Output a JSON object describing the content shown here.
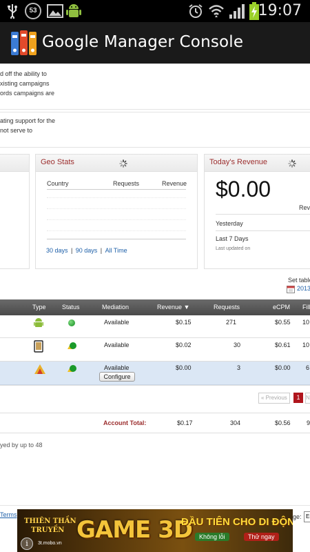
{
  "status_bar": {
    "notification_count": "53",
    "time": "19:07"
  },
  "app": {
    "title": "Google Manager Console"
  },
  "notices": [
    [
      "d off the ability to",
      "xisting campaigns",
      "ords campaigns are"
    ],
    [
      "ating support for the",
      " not serve to"
    ]
  ],
  "geo_stats": {
    "title": "Geo Stats",
    "columns": [
      "Country",
      "Requests",
      "Revenue"
    ],
    "links": [
      "30 days",
      "90 days",
      "All Time"
    ],
    "sep": "|"
  },
  "todays_revenue": {
    "title": "Today's Revenue",
    "amount": "$0.00",
    "rev_label": "Reve",
    "rows": [
      "Yesterday",
      "Last 7 Days"
    ],
    "updated": "Last updated on"
  },
  "table_settings": {
    "label": "Set table",
    "date": "2013"
  },
  "table": {
    "headers": [
      "Type",
      "Status",
      "Mediation",
      "Revenue",
      "Requests",
      "eCPM",
      "Fill"
    ],
    "sort_arrow": "▼",
    "rows": [
      {
        "mediation": "Available",
        "revenue": "$0.15",
        "requests": "271",
        "ecpm": "$0.55",
        "fill": "10",
        "type_icon": "android-icon",
        "status_color": "#1aa32a"
      },
      {
        "mediation": "Available",
        "revenue": "$0.02",
        "requests": "30",
        "ecpm": "$0.61",
        "fill": "10",
        "type_icon": "tablet-icon",
        "status_color": "#1aa32a"
      },
      {
        "mediation": "Available",
        "configure": "Configure",
        "revenue": "$0.00",
        "requests": "3",
        "ecpm": "$0.00",
        "fill": "6",
        "type_icon": "adwords-icon",
        "status_color": "#1aa32a"
      }
    ],
    "pagination": {
      "previous": "« Previous",
      "page": "1",
      "next": "N"
    },
    "total": {
      "label": "Account Total:",
      "revenue": "$0.17",
      "requests": "304",
      "ecpm": "$0.56",
      "fill": "9"
    }
  },
  "footer_note": "yed by up to 48",
  "bottom": {
    "terms": "Terms",
    "lang_label": "ge:",
    "lang_value": "En"
  },
  "ad_banner": {
    "brand_line1": "THIÊN THẦN",
    "brand_line2": "TRUYỀN",
    "brand_url": "3t.mobo.vn",
    "game_text": "GAME 3D",
    "headline": "ĐẦU TIÊN CHO DI ĐỘNG",
    "tag1": "Không lỗi",
    "tag2": "Thử ngay"
  },
  "colors": {
    "header_red": "#9b2d2d",
    "link_blue": "#1d5fa8",
    "table_header_bg": "#5a5a5a",
    "selected_row_bg": "#dbe7f5"
  }
}
